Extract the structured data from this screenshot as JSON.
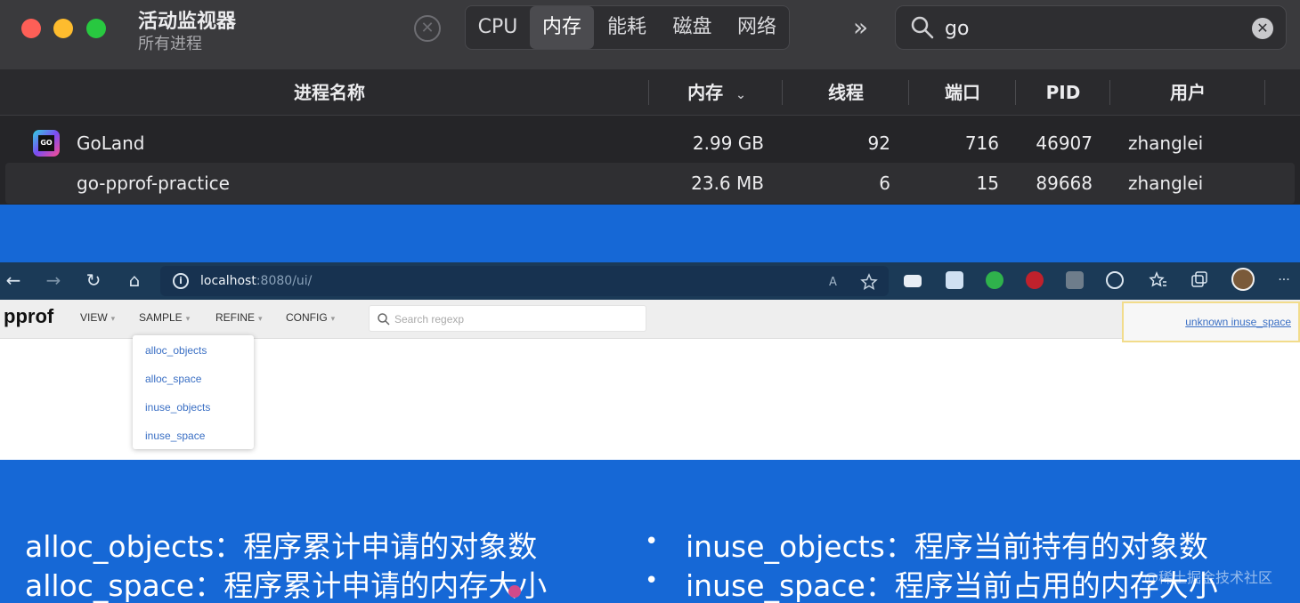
{
  "activity_monitor": {
    "title": "活动监视器",
    "subtitle": "所有进程",
    "stop_glyph": "✕",
    "tabs": [
      "CPU",
      "内存",
      "能耗",
      "磁盘",
      "网络"
    ],
    "active_tab": "内存",
    "overflow_glyph": "»",
    "search": {
      "value": "go",
      "clear_glyph": "✕"
    },
    "columns": [
      "进程名称",
      "内存",
      "线程",
      "端口",
      "PID",
      "用户"
    ],
    "sort_glyph": "⌄",
    "rows": [
      {
        "name": "GoLand",
        "memory": "2.99 GB",
        "threads": "92",
        "ports": "716",
        "pid": "46907",
        "user": "zhanglei",
        "icon": "goland-app-icon",
        "icon_text": "GO"
      },
      {
        "name": "go-pprof-practice",
        "memory": "23.6 MB",
        "threads": "6",
        "ports": "15",
        "pid": "89668",
        "user": "zhanglei"
      }
    ]
  },
  "browser": {
    "url_host": "localhost",
    "url_rest": ":8080/ui/",
    "info_glyph": "i",
    "nav_glyphs": {
      "back": "←",
      "forward": "→",
      "reload": "↻",
      "home": "⌂",
      "more": "···"
    }
  },
  "pprof": {
    "title": "pprof",
    "menus": [
      {
        "label": "VIEW"
      },
      {
        "label": "SAMPLE"
      },
      {
        "label": "REFINE"
      },
      {
        "label": "CONFIG"
      }
    ],
    "menu_caret": "▾",
    "search_placeholder": "Search regexp",
    "legend_link": "unknown inuse_space",
    "sample_options": [
      "alloc_objects",
      "alloc_space",
      "inuse_objects",
      "inuse_space"
    ]
  },
  "caption": {
    "line1_left": "alloc_objects：程序累计申请的对象数",
    "line2_left": "alloc_space：程序累计申请的内存大小",
    "line1_right": "inuse_objects：程序当前持有的对象数",
    "line2_right": "inuse_space：程序当前占用的内存大小",
    "bullet": "•",
    "watermark": "@稀土掘金技术社区"
  },
  "colors": {
    "background_blue": "#1668d6",
    "am_dark": "#252528",
    "browser_bar": "#1b3a57",
    "link_blue": "#3a6fc4"
  }
}
